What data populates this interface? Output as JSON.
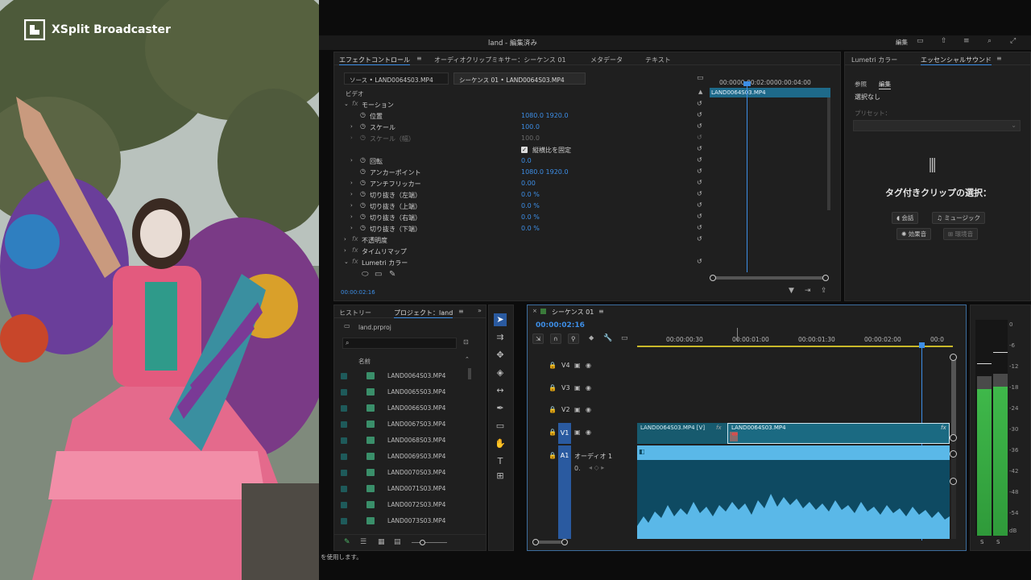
{
  "overlay": {
    "brand": "XSplit Broadcaster"
  },
  "window": {
    "title": "land - 編集済み",
    "edit_label": "編集"
  },
  "effect_panel": {
    "tabs": [
      "エフェクトコントロール",
      "オーディオクリップミキサー：シーケンス 01",
      "メタデータ",
      "テキスト"
    ],
    "source_tab": "ソース • LAND0064S03.MP4",
    "sequence_tab": "シーケンス 01 • LAND0064S03.MP4",
    "timecodes": [
      "00:00",
      "00:00:02:00",
      "00:00:04:00"
    ],
    "clip_label": "LAND0064S03.MP4",
    "section_video": "ビデオ",
    "rows": [
      {
        "name": "モーション",
        "value": ""
      },
      {
        "name": "位置",
        "value": "1080.0   1920.0"
      },
      {
        "name": "スケール",
        "value": "100.0"
      },
      {
        "name": "スケール（幅）",
        "value": "100.0"
      },
      {
        "name": "縦横比を固定",
        "value": ""
      },
      {
        "name": "回転",
        "value": "0.0"
      },
      {
        "name": "アンカーポイント",
        "value": "1080.0   1920.0"
      },
      {
        "name": "アンチフリッカー",
        "value": "0.00"
      },
      {
        "name": "切り抜き（左端）",
        "value": "0.0 %"
      },
      {
        "name": "切り抜き（上端）",
        "value": "0.0 %"
      },
      {
        "name": "切り抜き（右端）",
        "value": "0.0 %"
      },
      {
        "name": "切り抜き（下端）",
        "value": "0.0 %"
      },
      {
        "name": "不透明度",
        "value": ""
      },
      {
        "name": "タイムリマップ",
        "value": ""
      },
      {
        "name": "Lumetri カラー",
        "value": ""
      }
    ],
    "current_time": "00:00:02:16"
  },
  "essential_sound": {
    "tabs": [
      "Lumetri カラー",
      "エッセンシャルサウンド"
    ],
    "subtabs": [
      "参照",
      "編集"
    ],
    "selection": "選択なし",
    "preset_label": "プリセット：",
    "tag_title": "タグ付きクリップの選択：",
    "buttons": [
      "会話",
      "ミュージック",
      "効果音",
      "環境音"
    ]
  },
  "project_panel": {
    "tabs": [
      "ヒストリー",
      "プロジェクト：land"
    ],
    "file": "land.prproj",
    "column_name": "名前",
    "items": [
      "LAND0064S03.MP4",
      "LAND0065S03.MP4",
      "LAND0066S03.MP4",
      "LAND0067S03.MP4",
      "LAND0068S03.MP4",
      "LAND0069S03.MP4",
      "LAND0070S03.MP4",
      "LAND0071S03.MP4",
      "LAND0072S03.MP4",
      "LAND0073S03.MP4"
    ]
  },
  "timeline": {
    "title": "シーケンス 01",
    "timecode": "00:00:02:16",
    "ruler": [
      "00:00:00:30",
      "00:00:01:00",
      "00:00:01:30",
      "00:00:02:00",
      "00:0"
    ],
    "tracks": [
      "V4",
      "V3",
      "V2",
      "V1",
      "A1"
    ],
    "audio_track_name": "オーディオ 1",
    "audio_vol": "0.",
    "clip1": "LAND0064S03.MP4 [V]",
    "clip2": "LAND0064S03.MP4",
    "fx": "fx"
  },
  "meter": {
    "labels": [
      "0",
      "-6",
      "-12",
      "-18",
      "-24",
      "-30",
      "-36",
      "-42",
      "-48",
      "-54",
      "dB"
    ],
    "left_level": 0.74,
    "right_level": 0.75,
    "solo": [
      "S",
      "S"
    ]
  },
  "status": {
    "text": "を使用します。"
  }
}
